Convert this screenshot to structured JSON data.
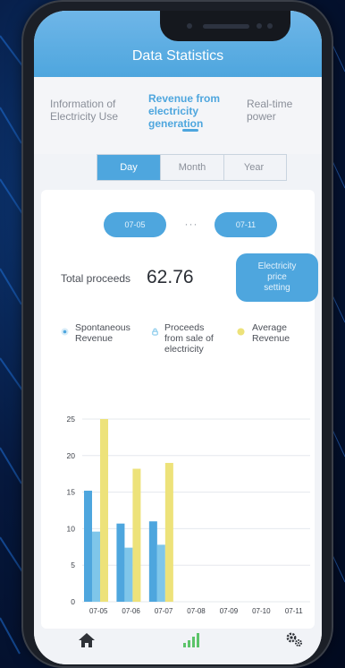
{
  "header": {
    "title": "Data Statistics"
  },
  "tabs": [
    {
      "label_lines": [
        "Information of",
        "Electricity Use"
      ],
      "active": false
    },
    {
      "label_lines": [
        "Revenue from",
        "electricity",
        "generation"
      ],
      "active": true
    },
    {
      "label_lines": [
        "Real-time",
        "power"
      ],
      "active": false
    }
  ],
  "period_tabs": {
    "day": "Day",
    "month": "Month",
    "year": "Year",
    "selected": "Day"
  },
  "date_range": {
    "start": "07-05",
    "separator": "···",
    "end": "07-11"
  },
  "summary": {
    "total_label": "Total proceeds",
    "total_value": "62.76"
  },
  "price_button": {
    "lines": [
      "Electricity",
      "price",
      "setting"
    ]
  },
  "colors": {
    "accent": "#4ea6de",
    "bar_spontaneous": "#4ea6de",
    "bar_sale": "#7fc6ea",
    "bar_average": "#ede27a"
  },
  "legend": [
    {
      "lines": [
        "Spontaneous",
        "Revenue"
      ],
      "icon": "target-icon",
      "color": "#4ea6de"
    },
    {
      "lines": [
        "Proceeds",
        "from sale of",
        "electricity"
      ],
      "icon": "lock-icon",
      "color": "#7fc6ea"
    },
    {
      "lines": [
        "Average",
        "Revenue"
      ],
      "icon": "dot-icon",
      "color": "#ede27a"
    }
  ],
  "chart_data": {
    "type": "bar",
    "categories": [
      "07-05",
      "07-06",
      "07-07",
      "07-08",
      "07-09",
      "07-10",
      "07-11"
    ],
    "series": [
      {
        "name": "Spontaneous Revenue",
        "values": [
          15.2,
          10.7,
          11.0,
          null,
          null,
          null,
          null
        ]
      },
      {
        "name": "Proceeds from sale of electricity",
        "values": [
          9.6,
          7.4,
          7.8,
          null,
          null,
          null,
          null
        ]
      },
      {
        "name": "Average Revenue",
        "values": [
          25.0,
          18.2,
          19.0,
          null,
          null,
          null,
          null
        ]
      }
    ],
    "yticks": [
      0,
      5,
      10,
      15,
      20,
      25
    ],
    "ylim": [
      0,
      25
    ],
    "grid": true
  },
  "bottom_nav": [
    {
      "icon": "home-icon"
    },
    {
      "icon": "bar-chart-icon",
      "active": true
    },
    {
      "icon": "gear-icon"
    }
  ]
}
